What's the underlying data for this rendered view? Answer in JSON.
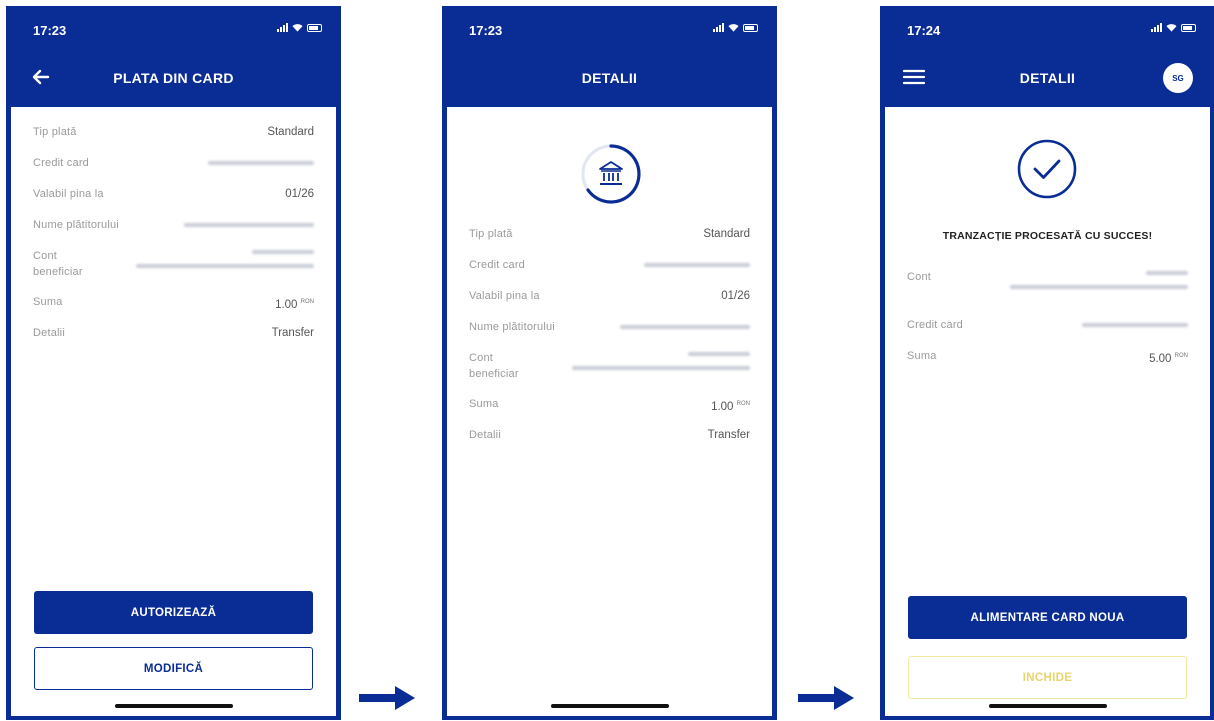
{
  "screens": [
    {
      "status_time": "17:23",
      "title": "PLATA DIN CARD",
      "rows": [
        {
          "label": "Tip plată",
          "value": "Standard"
        },
        {
          "label": "Credit card",
          "value": ""
        },
        {
          "label": "Valabil pina la",
          "value": "01/26"
        },
        {
          "label": "Nume plătitorului",
          "value": ""
        },
        {
          "label": "Cont beneficiar",
          "value": ""
        },
        {
          "label": "Suma",
          "value": "1.00",
          "unit": "RON"
        },
        {
          "label": "Detalii",
          "value": "Transfer"
        }
      ],
      "primary_button": "AUTORIZEAZĂ",
      "secondary_button": "MODIFICĂ"
    },
    {
      "status_time": "17:23",
      "title": "DETALII",
      "rows": [
        {
          "label": "Tip plată",
          "value": "Standard"
        },
        {
          "label": "Credit card",
          "value": ""
        },
        {
          "label": "Valabil pina la",
          "value": "01/26"
        },
        {
          "label": "Nume plătitorului",
          "value": ""
        },
        {
          "label": "Cont beneficiar",
          "value": ""
        },
        {
          "label": "Suma",
          "value": "1.00",
          "unit": "RON"
        },
        {
          "label": "Detalii",
          "value": "Transfer"
        }
      ]
    },
    {
      "status_time": "17:24",
      "title": "DETALII",
      "avatar_initials": "SG",
      "success_message": "TRANZACȚIE PROCESATĂ CU SUCCES!",
      "rows": [
        {
          "label": "Cont",
          "value": ""
        },
        {
          "label": "Credit card",
          "value": ""
        },
        {
          "label": "Suma",
          "value": "5.00",
          "unit": "RON"
        }
      ],
      "primary_button": "ALIMENTARE CARD NOUA",
      "secondary_button": "INCHIDE"
    }
  ],
  "colors": {
    "brand_blue": "#0a2c95",
    "close_button_yellow": "#e8d469"
  },
  "icons": [
    "back-arrow-icon",
    "bank-icon",
    "checkmark-icon",
    "menu-icon",
    "flow-arrow-icon"
  ]
}
